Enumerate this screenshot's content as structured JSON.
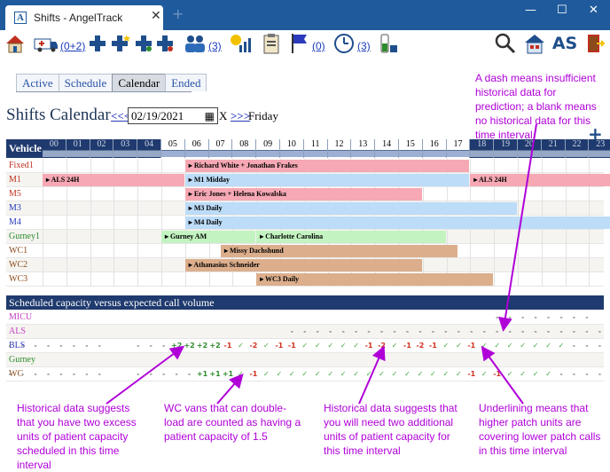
{
  "browser": {
    "tab_title": "Shifts - AngelTrack",
    "favicon": "A",
    "new_tab": "+",
    "min": "—",
    "max": "☐",
    "close": "✕",
    "tab_close": "✕"
  },
  "toolbar": {
    "counts": [
      "(0+2)",
      "(3)",
      "(0)",
      "(3)"
    ],
    "user_initials": "AS"
  },
  "view_tabs": [
    "Active",
    "Schedule",
    "Calendar",
    "Ended"
  ],
  "page": {
    "title": "Shifts Calendar",
    "prev": "<<<",
    "next": ">>>",
    "date": "02/19/2021",
    "clear": "X",
    "weekday": "Friday",
    "add": "+"
  },
  "grid": {
    "vehicle_header": "Vehicle",
    "hours": [
      "00",
      "01",
      "02",
      "03",
      "04",
      "05",
      "06",
      "07",
      "08",
      "09",
      "10",
      "11",
      "12",
      "13",
      "14",
      "15",
      "16",
      "17",
      "18",
      "19",
      "20",
      "21",
      "22",
      "23"
    ],
    "rows": [
      {
        "name": "Fixed1",
        "color": "#c0301f"
      },
      {
        "name": "M1",
        "color": "#c0301f"
      },
      {
        "name": "M5",
        "color": "#c0301f"
      },
      {
        "name": "M3",
        "color": "#2a3bbb"
      },
      {
        "name": "M4",
        "color": "#2a3bbb"
      },
      {
        "name": "Gurney1",
        "color": "#2e8b2e"
      },
      {
        "name": "WC1",
        "color": "#8b4a1a"
      },
      {
        "name": "WC2",
        "color": "#8b4a1a"
      },
      {
        "name": "WC3",
        "color": "#8b4a1a"
      }
    ],
    "shifts": [
      {
        "row": 0,
        "start": 6,
        "end": 18,
        "label": "▸ Richard White + Jonathan Frakes",
        "color": "#f6a8b4"
      },
      {
        "row": 1,
        "start": 0,
        "end": 6,
        "label": "▸ ALS 24H",
        "color": "#f6a8b4"
      },
      {
        "row": 1,
        "start": 6,
        "end": 18,
        "label": "▸ M1 Midday",
        "color": "#bcdcf8"
      },
      {
        "row": 1,
        "start": 18,
        "end": 24,
        "label": "▸ ALS 24H",
        "color": "#f6a8b4"
      },
      {
        "row": 2,
        "start": 6,
        "end": 16,
        "label": "▸ Eric Jones + Helena Kowalska",
        "color": "#f6a8b4"
      },
      {
        "row": 3,
        "start": 6,
        "end": 20,
        "label": "▸ M3 Daily",
        "color": "#bcdcf8"
      },
      {
        "row": 4,
        "start": 6,
        "end": 24,
        "label": "▸ M4 Daily",
        "color": "#bcdcf8"
      },
      {
        "row": 5,
        "start": 5,
        "end": 9,
        "label": "▸ Gurney AM",
        "color": "#c3f3c0"
      },
      {
        "row": 5,
        "start": 9,
        "end": 17,
        "label": "▸ Charlotte Carolina",
        "color": "#c3f3c0"
      },
      {
        "row": 6,
        "start": 7.5,
        "end": 17.5,
        "label": "▸ Missy Dachshund",
        "color": "#dcae8c"
      },
      {
        "row": 7,
        "start": 6,
        "end": 16,
        "label": "▸ Athanasius Schneider",
        "color": "#dcae8c"
      },
      {
        "row": 8,
        "start": 9,
        "end": 19,
        "label": "▸ WC3 Daily",
        "color": "#dcae8c"
      }
    ]
  },
  "capacity": {
    "header": "Scheduled capacity versus expected call volume",
    "rows": [
      {
        "name": "MICU",
        "color": "#c040c0",
        "cells": [
          "",
          "",
          "",
          "",
          "",
          "",
          "",
          "",
          "",
          "",
          "",
          "",
          "",
          "",
          "",
          "",
          "",
          "",
          "",
          "",
          "",
          "",
          "",
          "",
          "",
          "",
          "",
          "",
          "",
          "",
          "",
          "",
          "",
          "",
          "",
          "",
          "",
          "",
          "-",
          "-",
          "-",
          "-",
          "-",
          "-",
          "-",
          "-"
        ]
      },
      {
        "name": "ALS",
        "color": "#c040c0",
        "cells": [
          "",
          "",
          "",
          "",
          "",
          "",
          "",
          "",
          "",
          "",
          "",
          "",
          "",
          "",
          "",
          "",
          "",
          "",
          "",
          "",
          "",
          "",
          "-",
          "-",
          "-",
          "-",
          "-",
          "-",
          "-",
          "-",
          "-",
          "-",
          "-",
          "-",
          "-",
          "-",
          "-",
          "-",
          "-",
          "-",
          "-",
          "-",
          "-",
          "-",
          "-",
          "-",
          "-",
          "-"
        ]
      },
      {
        "name": "BLS",
        "color": "#2a3bbb",
        "cells": [
          "-",
          "-",
          "-",
          "-",
          "-",
          "-",
          "-",
          "-",
          "",
          "",
          "-",
          "-",
          "-",
          "+2",
          "+2",
          "+2",
          "+2",
          "-1",
          "✓",
          "-2",
          "✓",
          "-1",
          "-1",
          "✓",
          "✓",
          "✓",
          "✓",
          "✓",
          "-1",
          "-2",
          "✓",
          "-1",
          "-2",
          "-1",
          "✓",
          "✓",
          "-1",
          "✓",
          "✓",
          "✓",
          "✓",
          "✓",
          "✓",
          "✓",
          "-",
          "-",
          "-",
          "-"
        ]
      },
      {
        "name": "Gurney",
        "color": "#2e8b2e",
        "cells": [
          "",
          "",
          "",
          "",
          "",
          "",
          "",
          "",
          "",
          "",
          "",
          "",
          "",
          "",
          "",
          "",
          "",
          "",
          "",
          "",
          "",
          "",
          "",
          "",
          "",
          "",
          "",
          "",
          "",
          "",
          "",
          "",
          "",
          "",
          "",
          "",
          "",
          "",
          "",
          "",
          "",
          "",
          "",
          "",
          "",
          "",
          "",
          ""
        ]
      },
      {
        "name": "WC",
        "color": "#8b4a1a",
        "cells": [
          "-",
          "-",
          "-",
          "-",
          "-",
          "-",
          "-",
          "-",
          "",
          "",
          "-",
          "-",
          "-",
          "-",
          "-",
          "+1",
          "+1",
          "+1",
          "✓",
          "-1",
          "✓",
          "✓",
          "✓",
          "✓",
          "✓",
          "✓",
          "✓",
          "✓",
          "✓",
          "✓",
          "✓",
          "✓",
          "✓",
          "✓",
          "✓",
          "✓",
          "-1",
          "✓",
          "-1",
          "✓",
          "✓",
          "✓",
          "✓",
          "-",
          "-",
          "-",
          "-",
          "-"
        ]
      }
    ]
  },
  "annotations": {
    "dash": "A dash means insufficient historical data for prediction; a blank means no historical data for this time interval",
    "excess": "Historical data suggests that you have two excess units of patient capacity scheduled in this time interval",
    "wc": "WC vans that can double-load are counted as having a patient capacity of 1.5",
    "need": "Historical data suggests that you will need two additional units of patient capacity for this time interval",
    "underline": "Underlining means that higher patch units are covering lower patch calls in this time interval"
  }
}
